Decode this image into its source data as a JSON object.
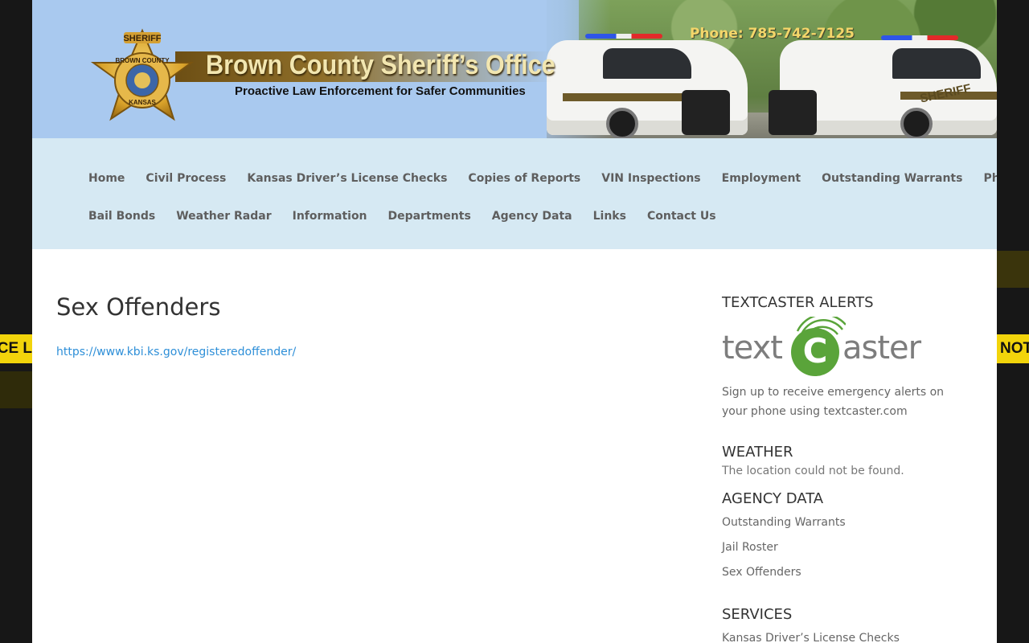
{
  "background": {
    "tape_left_text": "CE L",
    "tape_right_text": "NOT",
    "tape_color": "#f2d40b"
  },
  "header": {
    "title": "Brown County Sheriff’s Office",
    "tagline": "Proactive Law Enforcement for Safer Communities",
    "phone": "Phone: 785-742-7125",
    "badge_top": "SHERIFF",
    "badge_ring_top": "BROWN COUNTY",
    "badge_ring_bottom": "KANSAS",
    "car_label": "SHERIFF"
  },
  "nav": {
    "row1": [
      "Home",
      "Civil Process",
      "Kansas Driver’s License Checks",
      "Copies of Reports",
      "VIN Inspections",
      "Employment",
      "Outstanding Warrants",
      "Photos"
    ],
    "row2": [
      "Bail Bonds",
      "Weather Radar",
      "Information",
      "Departments",
      "Agency Data",
      "Links",
      "Contact Us"
    ]
  },
  "main": {
    "title": "Sex Offenders",
    "link": "https://www.kbi.ks.gov/registeredoffender/"
  },
  "sidebar": {
    "textcaster": {
      "title": "TEXTCASTER ALERTS",
      "logo_left": "text",
      "logo_mid": "C",
      "logo_right": "aster",
      "description": "Sign up to receive emergency alerts on your phone using textcaster.com"
    },
    "weather": {
      "title": "WEATHER",
      "message": "The location could not be found."
    },
    "agency": {
      "title": "AGENCY DATA",
      "items": [
        "Outstanding Warrants",
        "Jail Roster",
        "Sex Offenders"
      ]
    },
    "services": {
      "title": "SERVICES",
      "items": [
        "Kansas Driver’s License Checks"
      ]
    }
  },
  "colors": {
    "nav_bg": "#d6e9f3",
    "link": "#2e8fd8",
    "textcaster_green": "#5aa43a",
    "phone": "#f4d66a"
  }
}
